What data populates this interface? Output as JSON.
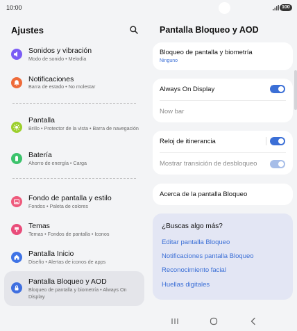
{
  "status_bar": {
    "time": "10:00",
    "battery": "100"
  },
  "left": {
    "title": "Ajustes",
    "items": [
      {
        "label": "Sonidos y vibración",
        "sub": "Modo de sonido  •  Melodía",
        "color": "#7b5cf5"
      },
      {
        "label": "Notificaciones",
        "sub": "Barra de estado  •  No molestar",
        "color": "#ee6b3a"
      },
      {
        "label": "Pantalla",
        "sub": "Brillo  •  Protector de la vista  •  Barra de navegación",
        "color": "#9ccf2c"
      },
      {
        "label": "Batería",
        "sub": "Ahorro de energía  •  Carga",
        "color": "#3cc36c"
      },
      {
        "label": "Fondo de pantalla y estilo",
        "sub": "Fondos  •  Paleta de colores",
        "color": "#ee5a7c"
      },
      {
        "label": "Temas",
        "sub": "Temas  •  Fondos de pantalla  •  Iconos",
        "color": "#e94c7a"
      },
      {
        "label": "Pantalla Inicio",
        "sub": "Diseño  •  Alertas de iconos de apps",
        "color": "#3f73e6"
      },
      {
        "label": "Pantalla Bloqueo y AOD",
        "sub": "Bloqueo de pantalla y biometría  •  Always On Display",
        "color": "#3f6fe0"
      }
    ]
  },
  "right": {
    "title": "Pantalla Bloqueo y AOD",
    "lock_biometrics": {
      "label": "Bloqueo de pantalla y biometría",
      "value": "Ninguno"
    },
    "aod": {
      "label": "Always On Display",
      "enabled": true
    },
    "now_bar": {
      "label": "Now bar"
    },
    "roaming_clock": {
      "label": "Reloj de itinerancia",
      "enabled": true
    },
    "unlock_transition": {
      "label": "Mostrar transición de desbloqueo",
      "enabled": true
    },
    "about": {
      "label": "Acerca de la pantalla Bloqueo"
    },
    "suggestions": {
      "heading": "¿Buscas algo más?",
      "links": [
        "Editar pantalla Bloqueo",
        "Notificaciones pantalla Bloqueo",
        "Reconocimiento facial",
        "Huellas digitales"
      ]
    }
  },
  "colors": {
    "accent": "#3b6fd6",
    "background": "#f3f4f6",
    "selected": "#e4e5ea"
  },
  "icons": [
    "search-icon",
    "speaker-icon",
    "bell-icon",
    "sun-icon",
    "battery-icon",
    "image-icon",
    "brush-icon",
    "home-icon",
    "lock-icon",
    "recents-icon",
    "home-nav-icon",
    "back-icon"
  ]
}
